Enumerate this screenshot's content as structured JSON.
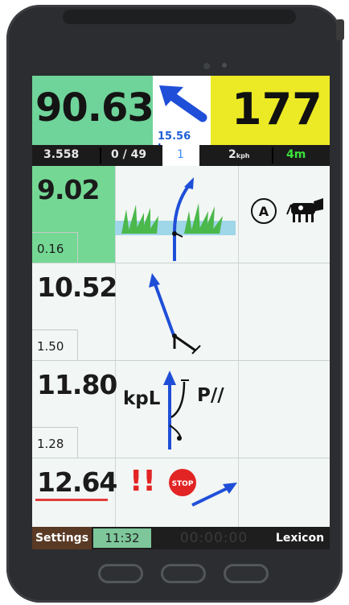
{
  "top": {
    "odometer": "90.63",
    "next_distance": "15.56 km",
    "speed_limit": "177"
  },
  "status": {
    "partial": "3.558",
    "progress": "0 / 49",
    "page": "1",
    "speed_value": "2",
    "speed_unit": "kph",
    "gps": "4m"
  },
  "rows": [
    {
      "total": "9.02",
      "partial": "0.16",
      "label_left": "",
      "label_right": "",
      "note_symbol": "A",
      "note_icon": "cow-icon"
    },
    {
      "total": "10.52",
      "partial": "1.50",
      "label_left": "",
      "label_right": ""
    },
    {
      "total": "11.80",
      "partial": "1.28",
      "label_left": "kpL",
      "label_right": "P//"
    },
    {
      "total": "12.64",
      "partial": "",
      "label_left": "",
      "label_right": "",
      "danger": "!!",
      "stop_text": "STOP"
    }
  ],
  "bottom": {
    "settings_label": "Settings",
    "clock": "11:32",
    "timer": "00:00:00",
    "lexicon_label": "Lexicon"
  },
  "colors": {
    "odometer_bg": "#6fd49a",
    "speed_bg": "#ecea24",
    "arrow_blue": "#1f4fd8",
    "active_row_bg": "#74d894"
  }
}
